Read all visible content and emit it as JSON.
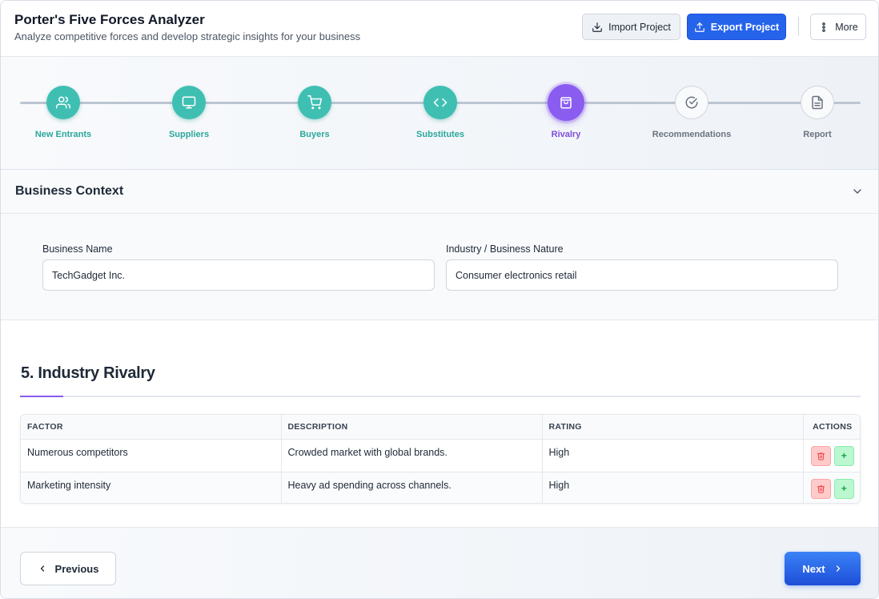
{
  "header": {
    "title": "Porter's Five Forces Analyzer",
    "subtitle": "Analyze competitive forces and develop strategic insights for your business",
    "import_label": "Import Project",
    "export_label": "Export Project",
    "more_label": "More"
  },
  "steps": [
    {
      "label": "New Entrants",
      "status": "done",
      "icon": "users-icon"
    },
    {
      "label": "Suppliers",
      "status": "done",
      "icon": "monitor-icon"
    },
    {
      "label": "Buyers",
      "status": "done",
      "icon": "cart-icon"
    },
    {
      "label": "Substitutes",
      "status": "done",
      "icon": "code-icon"
    },
    {
      "label": "Rivalry",
      "status": "active",
      "icon": "bag-icon"
    },
    {
      "label": "Recommendations",
      "status": "todo",
      "icon": "check-circle-icon"
    },
    {
      "label": "Report",
      "status": "todo",
      "icon": "document-icon"
    }
  ],
  "context": {
    "title": "Business Context",
    "business_name_label": "Business Name",
    "business_name_value": "TechGadget Inc.",
    "industry_label": "Industry / Business Nature",
    "industry_value": "Consumer electronics retail"
  },
  "section": {
    "title": "5. Industry Rivalry"
  },
  "table": {
    "headers": [
      "FACTOR",
      "DESCRIPTION",
      "RATING",
      "ACTIONS"
    ],
    "rows": [
      {
        "factor": "Numerous competitors",
        "description": "Crowded market with global brands.",
        "rating": "High"
      },
      {
        "factor": "Marketing intensity",
        "description": "Heavy ad spending across channels.",
        "rating": "High"
      }
    ],
    "add_glyph": "+"
  },
  "footer": {
    "prev_label": "Previous",
    "next_label": "Next"
  },
  "colors": {
    "done": "#3ebfb2",
    "active": "#8a5cf0",
    "primary": "#2563eb"
  }
}
